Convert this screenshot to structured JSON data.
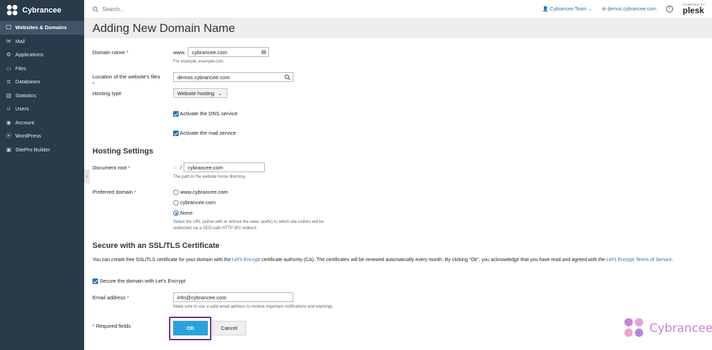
{
  "sidebar": {
    "brand": "Cybrancee",
    "items": [
      {
        "label": "Websites & Domains",
        "icon": "monitor-icon",
        "glyph": "🖵",
        "active": true
      },
      {
        "label": "Mail",
        "icon": "mail-icon",
        "glyph": "✉"
      },
      {
        "label": "Applications",
        "icon": "gear-icon",
        "glyph": "⚙"
      },
      {
        "label": "Files",
        "icon": "folder-icon",
        "glyph": "▭"
      },
      {
        "label": "Databases",
        "icon": "database-icon",
        "glyph": "≣"
      },
      {
        "label": "Statistics",
        "icon": "bar-chart-icon",
        "glyph": "▥"
      },
      {
        "label": "Users",
        "icon": "user-icon",
        "glyph": "☺"
      },
      {
        "label": "Account",
        "icon": "account-icon",
        "glyph": "◉"
      },
      {
        "label": "WordPress",
        "icon": "wordpress-icon",
        "glyph": "ⓦ"
      },
      {
        "label": "SitePro Builder",
        "icon": "sitepro-icon",
        "glyph": "▣"
      }
    ]
  },
  "topbar": {
    "search_placeholder": "Search...",
    "team": "Cybrancee Team ⌄",
    "domain": "demos.cybrancee.com",
    "help": "?",
    "powered_by": "POWERED BY",
    "plesk": "plesk"
  },
  "page": {
    "title": "Adding New Domain Name"
  },
  "form": {
    "domain_name_label": "Domain name",
    "www_prefix": "www.",
    "domain_value": "cybrancee.com",
    "domain_hint": "For example, example.com",
    "location_label": "Location of the website's files",
    "location_value": "demos.cybrancee.com",
    "hosting_type_label": "Hosting type",
    "hosting_type_value": "Website hosting",
    "dns_label": "Activate the DNS service",
    "mail_label": "Activate the mail service",
    "required_star": "*"
  },
  "hosting_settings": {
    "heading": "Hosting Settings",
    "docroot_label": "Document root",
    "docroot_slash": "/",
    "docroot_value": "cybrancee.com",
    "docroot_hint": "The path to the website home directory.",
    "preferred_label": "Preferred domain",
    "options": [
      "www.cybrancee.com",
      "cybrancee.com",
      "None"
    ],
    "selected_option": "None",
    "preferred_hint_1": "Select the URL (either with or without the www. prefix) to which site visitors will be",
    "preferred_hint_2": "redirected via a SEO-safe HTTP 301 redirect."
  },
  "ssl": {
    "heading": "Secure with an SSL/TLS Certificate",
    "desc_1": "You can create free SSL/TLS certificate for your domain with the",
    "desc_link_1": "Let's Encrypt",
    "desc_2": "certificate authority (CA). The certificates will be renewed automatically every month. By clicking \"Ok\", you acknowledge that you have read and agreed with the",
    "desc_link_2a": "Let's Encrypt",
    "desc_link_2b": "Terms of Service",
    "desc_end": ".",
    "secure_label": "Secure the domain with Let's Encrypt",
    "email_label": "Email address",
    "email_value": "info@cybrancee.com",
    "email_hint": "Make sure to use a valid email address to receive important notifications and warnings."
  },
  "footer": {
    "required_note": "Required fields",
    "ok_label": "OK",
    "cancel_label": "Cancel"
  },
  "watermark": {
    "text": "Cybrancee"
  },
  "colors": {
    "sidebar": "#293a4a",
    "accent": "#2874b6",
    "ok_button": "#29a3de",
    "highlight_frame": "#6f2a9e",
    "watermark": "#c983d3"
  }
}
